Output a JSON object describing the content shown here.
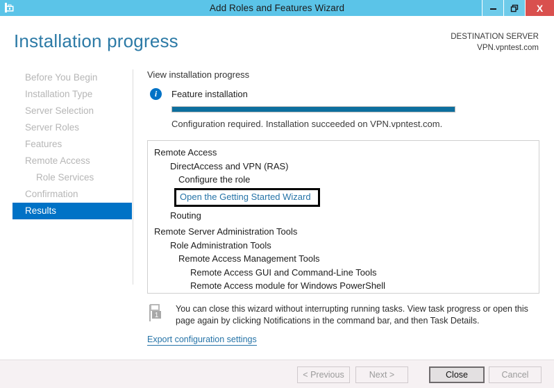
{
  "window": {
    "title": "Add Roles and Features Wizard",
    "icon": "server-toolbox-icon",
    "minimize_label": "–",
    "restore_label": "❐",
    "close_label": "X",
    "titlebar_color": "#5bc4e8",
    "close_color": "#d9504e"
  },
  "header": {
    "page_title": "Installation progress",
    "destination_label": "DESTINATION SERVER",
    "destination_value": "VPN.vpntest.com",
    "accent_color": "#2c7aa6"
  },
  "sidebar": {
    "items": [
      {
        "label": "Before You Begin",
        "level": 0,
        "active": false
      },
      {
        "label": "Installation Type",
        "level": 0,
        "active": false
      },
      {
        "label": "Server Selection",
        "level": 0,
        "active": false
      },
      {
        "label": "Server Roles",
        "level": 0,
        "active": false
      },
      {
        "label": "Features",
        "level": 0,
        "active": false
      },
      {
        "label": "Remote Access",
        "level": 0,
        "active": false
      },
      {
        "label": "Role Services",
        "level": 1,
        "active": false
      },
      {
        "label": "Confirmation",
        "level": 0,
        "active": false
      },
      {
        "label": "Results",
        "level": 0,
        "active": true
      }
    ],
    "active_color": "#0072c6"
  },
  "main": {
    "section_label": "View installation progress",
    "feature_label": "Feature installation",
    "info_icon": "info-icon",
    "info_icon_glyph": "i",
    "progress_percent": 100,
    "progress_color": "#0d6f9e",
    "status_text": "Configuration required. Installation succeeded on VPN.vpntest.com.",
    "results": [
      {
        "label": "Remote Access",
        "level": 0
      },
      {
        "label": "DirectAccess and VPN (RAS)",
        "level": 1
      },
      {
        "label": "Configure the role",
        "level": 2
      },
      {
        "label": "Routing",
        "level": 1
      },
      {
        "label": "Remote Server Administration Tools",
        "level": 0
      },
      {
        "label": "Role Administration Tools",
        "level": 1
      },
      {
        "label": "Remote Access Management Tools",
        "level": 2
      },
      {
        "label": "Remote Access GUI and Command-Line Tools",
        "level": 3
      },
      {
        "label": "Remote Access module for Windows PowerShell",
        "level": 3
      }
    ],
    "wizard_link": "Open the Getting Started Wizard",
    "wizard_link_color": "#2573a7",
    "wizard_link_highlighted": true
  },
  "notice": {
    "icon": "notification-flag-icon",
    "badge": "1",
    "text": "You can close this wizard without interrupting running tasks. View task progress or open this page again by clicking Notifications in the command bar, and then Task Details."
  },
  "export_link": "Export configuration settings",
  "footer": {
    "previous_label": "< Previous",
    "next_label": "Next >",
    "close_label": "Close",
    "cancel_label": "Cancel",
    "background": "#f6f1f3"
  }
}
